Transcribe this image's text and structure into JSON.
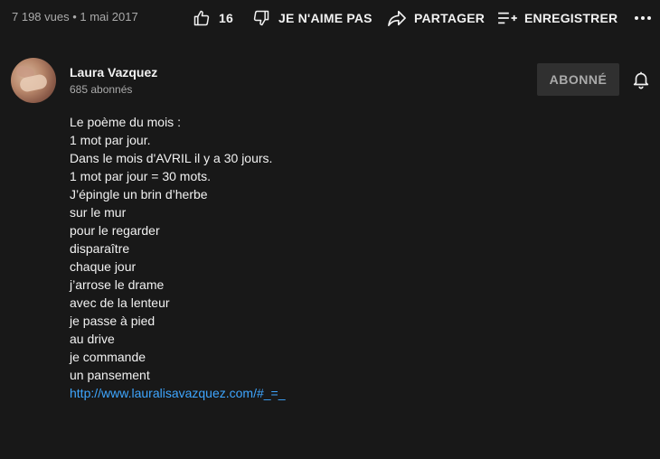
{
  "meta": {
    "views_date": "7 198 vues • 1 mai 2017"
  },
  "actions": {
    "like_count": "16",
    "dislike_label": "JE N'AIME PAS",
    "share_label": "PARTAGER",
    "save_label": "ENREGISTRER",
    "more_icon": "more-horiz-icon"
  },
  "channel": {
    "name": "Laura Vazquez",
    "subscribers": "685 abonnés",
    "subscribe_button": "ABONNÉ",
    "bell_icon": "bell-icon"
  },
  "description": {
    "intro": [
      "Le poème du mois :",
      "1 mot par jour.",
      "Dans le mois d'AVRIL il y a 30 jours.",
      "1 mot par jour = 30 mots."
    ],
    "poem": [
      "J’épingle un brin d’herbe",
      "sur le mur",
      "pour le regarder",
      "disparaître",
      "chaque jour",
      "j’arrose le drame",
      "avec de la lenteur",
      "je passe à pied",
      "au drive",
      "je commande",
      "un pansement"
    ],
    "link": "http://www.lauralisavazquez.com/#_=_"
  }
}
